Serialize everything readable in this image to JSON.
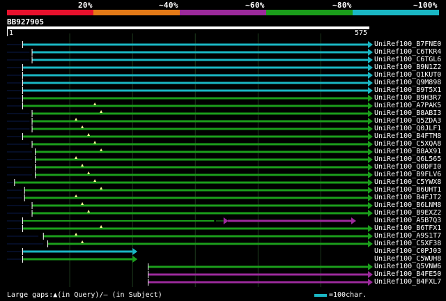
{
  "legend": {
    "labels": [
      "20%",
      "~40%",
      "~60%",
      "~80%",
      "~100%"
    ],
    "colors": [
      "#e8112d",
      "#e47a17",
      "#9c2a9c",
      "#1b9e1b",
      "#1ab7c4"
    ]
  },
  "query": {
    "id": "BB927905",
    "start": "1",
    "end": "575",
    "length": 575
  },
  "footer": {
    "text": "Large gaps:▲(in Query)/– (in Subject)",
    "scale_label": "=100char.",
    "scale_color": "#1ab7c4"
  },
  "hits": [
    {
      "name": "UniRef100_B7FNE0",
      "color": "cyan",
      "qs": 25,
      "qe": 575,
      "nq": 24
    },
    {
      "name": "UniRef100_C6TKR4",
      "color": "cyan",
      "qs": 40,
      "qe": 575,
      "nq": 36
    },
    {
      "name": "UniRef100_C6TGL6",
      "color": "cyan",
      "qs": 40,
      "qe": 575,
      "nq": 36
    },
    {
      "name": "UniRef100_B9N1Z2",
      "color": "cyan",
      "qs": 25,
      "qe": 575,
      "nq": 24
    },
    {
      "name": "UniRef100_Q1KUT0",
      "color": "cyan",
      "qs": 25,
      "qe": 575,
      "nq": 24
    },
    {
      "name": "UniRef100_Q9M898",
      "color": "cyan",
      "qs": 25,
      "qe": 575,
      "nq": 24
    },
    {
      "name": "UniRef100_B9T5X1",
      "color": "cyan",
      "qs": 25,
      "qe": 575,
      "nq": 24
    },
    {
      "name": "UniRef100_B9H3R7",
      "color": "green",
      "qs": 25,
      "qe": 575,
      "nq": 24
    },
    {
      "name": "UniRef100_A7PAK5",
      "color": "green",
      "qs": 25,
      "qe": 575,
      "nq": 24
    },
    {
      "name": "UniRef100_B8ABI3",
      "color": "green",
      "qs": 40,
      "qe": 575,
      "nq": 36
    },
    {
      "name": "UniRef100_Q5ZDA3",
      "color": "green",
      "qs": 40,
      "qe": 575,
      "nq": 36
    },
    {
      "name": "UniRef100_Q0JLF1",
      "color": "green",
      "qs": 40,
      "qe": 575,
      "nq": 36
    },
    {
      "name": "UniRef100_B4FTM8",
      "color": "green",
      "qs": 25,
      "qe": 575,
      "nq": 24
    },
    {
      "name": "UniRef100_C5XQA8",
      "color": "green",
      "qs": 40,
      "qe": 575,
      "nq": 36
    },
    {
      "name": "UniRef100_B8AX91",
      "color": "green",
      "qs": 45,
      "qe": 575,
      "nq": 40
    },
    {
      "name": "UniRef100_Q6L565",
      "color": "green",
      "qs": 45,
      "qe": 575,
      "nq": 40
    },
    {
      "name": "UniRef100_Q0DFI0",
      "color": "green",
      "qs": 45,
      "qe": 575,
      "nq": 40
    },
    {
      "name": "UniRef100_B9FLV6",
      "color": "green",
      "qs": 45,
      "qe": 575,
      "nq": 40
    },
    {
      "name": "UniRef100_C5YWX8",
      "color": "green",
      "qs": 12,
      "qe": 575,
      "nq": 10
    },
    {
      "name": "UniRef100_B6UHT1",
      "color": "green",
      "qs": 28,
      "qe": 575,
      "nq": 24
    },
    {
      "name": "UniRef100_B4FJT2",
      "color": "green",
      "qs": 28,
      "qe": 575,
      "nq": 24
    },
    {
      "name": "UniRef100_B6LNM8",
      "color": "green",
      "qs": 40,
      "qe": 575,
      "nq": 36
    },
    {
      "name": "UniRef100_B9EXZ2",
      "color": "green",
      "qs": 40,
      "qe": 575,
      "nq": 36
    },
    {
      "name": "UniRef100_A5B7Q3",
      "color": "mixed",
      "qs": 25,
      "qe": 575,
      "nq": 24
    },
    {
      "name": "UniRef100_B6TFX1",
      "color": "green",
      "qs": 25,
      "qe": 575,
      "nq": 24
    },
    {
      "name": "UniRef100_A9S1T7",
      "color": "green",
      "qs": 58,
      "qe": 575,
      "nq": 50
    },
    {
      "name": "UniRef100_C5XF38",
      "color": "green",
      "qs": 65,
      "qe": 575,
      "nq": 58
    },
    {
      "name": "UniRef100_C0PJ03",
      "color": "cyan",
      "qs": 25,
      "qe": 200,
      "nq": 24
    },
    {
      "name": "UniRef100_C5WUH8",
      "color": "green",
      "qs": 25,
      "qe": 200,
      "nq": 24
    },
    {
      "name": "UniRef100_Q5VNW6",
      "color": "green",
      "qs": 225,
      "qe": 575,
      "nq": 0
    },
    {
      "name": "UniRef100_B4FE50",
      "color": "purple",
      "qs": 225,
      "qe": 575,
      "nq": 0
    },
    {
      "name": "UniRef100_B4FXL7",
      "color": "purple",
      "qs": 225,
      "qe": 575,
      "nq": 0
    }
  ]
}
